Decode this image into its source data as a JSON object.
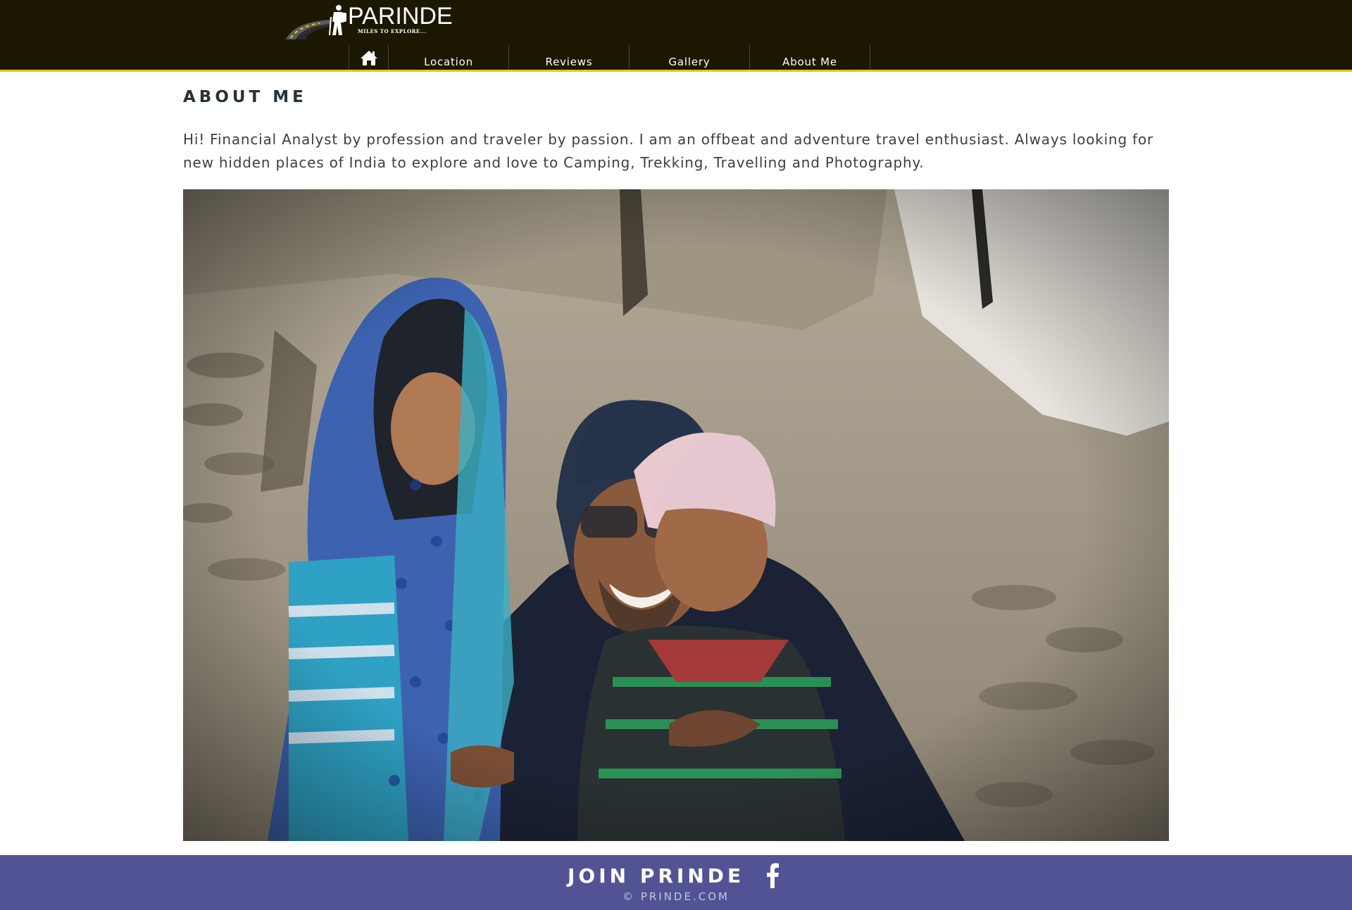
{
  "brand": {
    "name": "PARINDE",
    "tagline": "MILES TO EXPLORE..."
  },
  "nav": {
    "home_icon": "home-icon",
    "items": [
      {
        "label": "Location"
      },
      {
        "label": "Reviews"
      },
      {
        "label": "Gallery"
      },
      {
        "label": "About Me"
      }
    ]
  },
  "page": {
    "title": "ABOUT ME",
    "intro": "Hi! Financial Analyst by profession and traveler by passion. I am an offbeat and adventure travel enthusiast. Always looking for new hidden places of India to explore and love to Camping, Trekking, Travelling and Photography."
  },
  "photo": {
    "subject": "traveler-with-two-children"
  },
  "footer": {
    "join": "JOIN PRINDE",
    "social_icon": "facebook-icon",
    "copyright": "© PRINDE.COM"
  },
  "colors": {
    "header_bg": "#1c1700",
    "header_accent": "#e7c31a",
    "footer_bg": "#525394",
    "title_text": "#273238"
  }
}
